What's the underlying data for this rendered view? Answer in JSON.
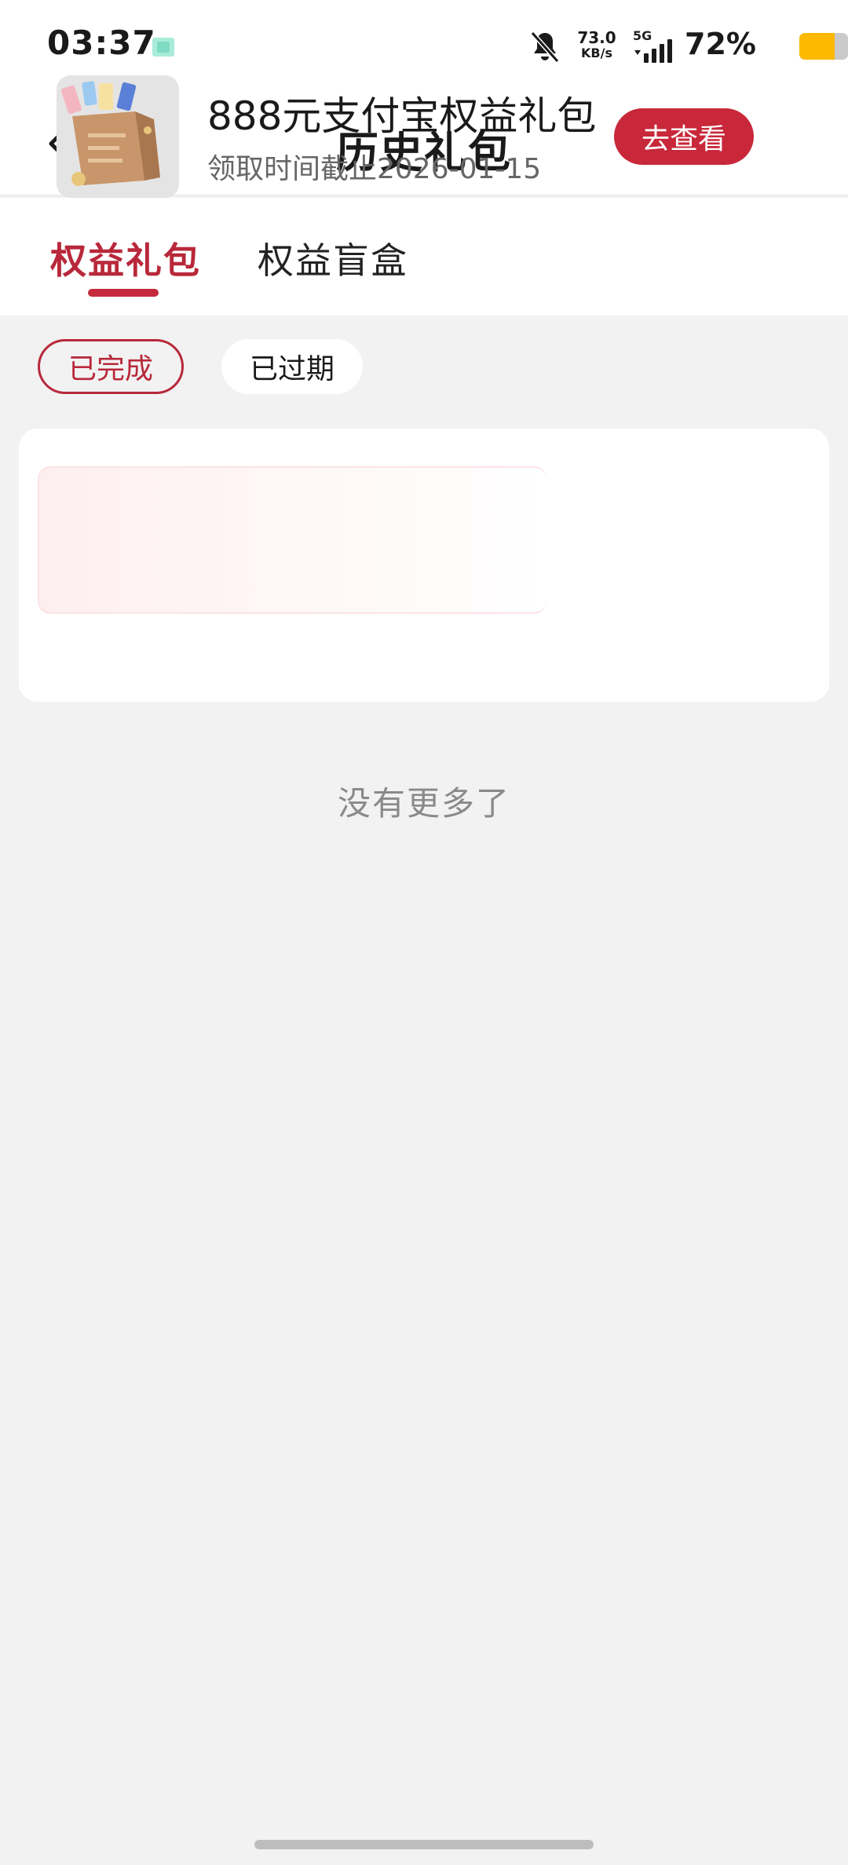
{
  "status_bar": {
    "time": "03:37",
    "net_speed_value": "73.0",
    "net_speed_unit": "KB/s",
    "network_type": "5G",
    "battery_percent_text": "72%",
    "battery_level": 0.72,
    "icons": [
      "notification-app-icon",
      "bell-muted-icon",
      "signal-icon",
      "battery-icon"
    ]
  },
  "nav": {
    "title": "历史礼包",
    "back_icon": "chevron-left-icon"
  },
  "tabs": [
    {
      "label": "权益礼包",
      "active": true
    },
    {
      "label": "权益盲盒",
      "active": false
    }
  ],
  "filters": [
    {
      "label": "已完成",
      "active": true
    },
    {
      "label": "已过期",
      "active": false
    }
  ],
  "gift_list": [
    {
      "thumbnail": "gift-bag-image",
      "title": "888元支付宝权益礼包",
      "deadline": "领取时间截止2026-01-15",
      "action_label": "去查看"
    }
  ],
  "footer_text": "没有更多了",
  "colors": {
    "accent": "#c8283a",
    "background": "#f2f2f2",
    "battery": "#fcb900"
  }
}
